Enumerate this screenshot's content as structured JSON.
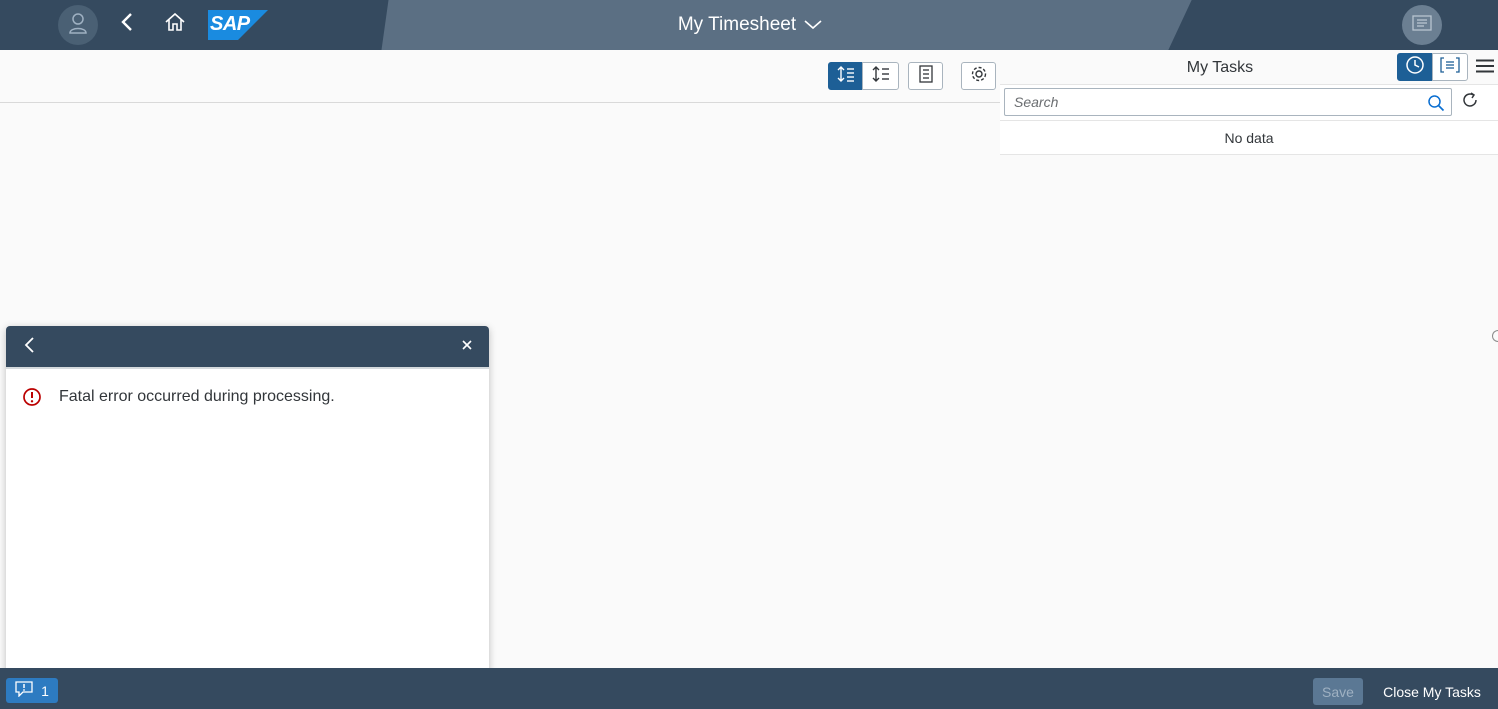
{
  "shell": {
    "title": "My Timesheet",
    "logo_text": "SAP",
    "icons": [
      "user-icon",
      "back-icon",
      "home-icon",
      "chevron-down-icon",
      "notifications-icon"
    ],
    "colors": {
      "bar": "#354a5f",
      "center": "#5b6f83",
      "logo": "#1a8be0"
    }
  },
  "toolbar": {
    "icons": [
      "expand-rows-icon",
      "collapse-rows-icon",
      "list-view-icon",
      "settings-icon"
    ]
  },
  "tasks": {
    "title": "My Tasks",
    "search_placeholder": "Search",
    "no_data": "No data",
    "icons": [
      "clock-icon",
      "document-list-icon",
      "menu-icon",
      "search-icon",
      "refresh-icon"
    ]
  },
  "popover": {
    "message": "Fatal error occurred during processing.",
    "icons": [
      "back-icon",
      "close-icon",
      "error-icon"
    ],
    "colors": {
      "error": "#bb0000"
    }
  },
  "footer": {
    "message_count": "1",
    "save_label": "Save",
    "close_tasks_label": "Close My Tasks"
  }
}
